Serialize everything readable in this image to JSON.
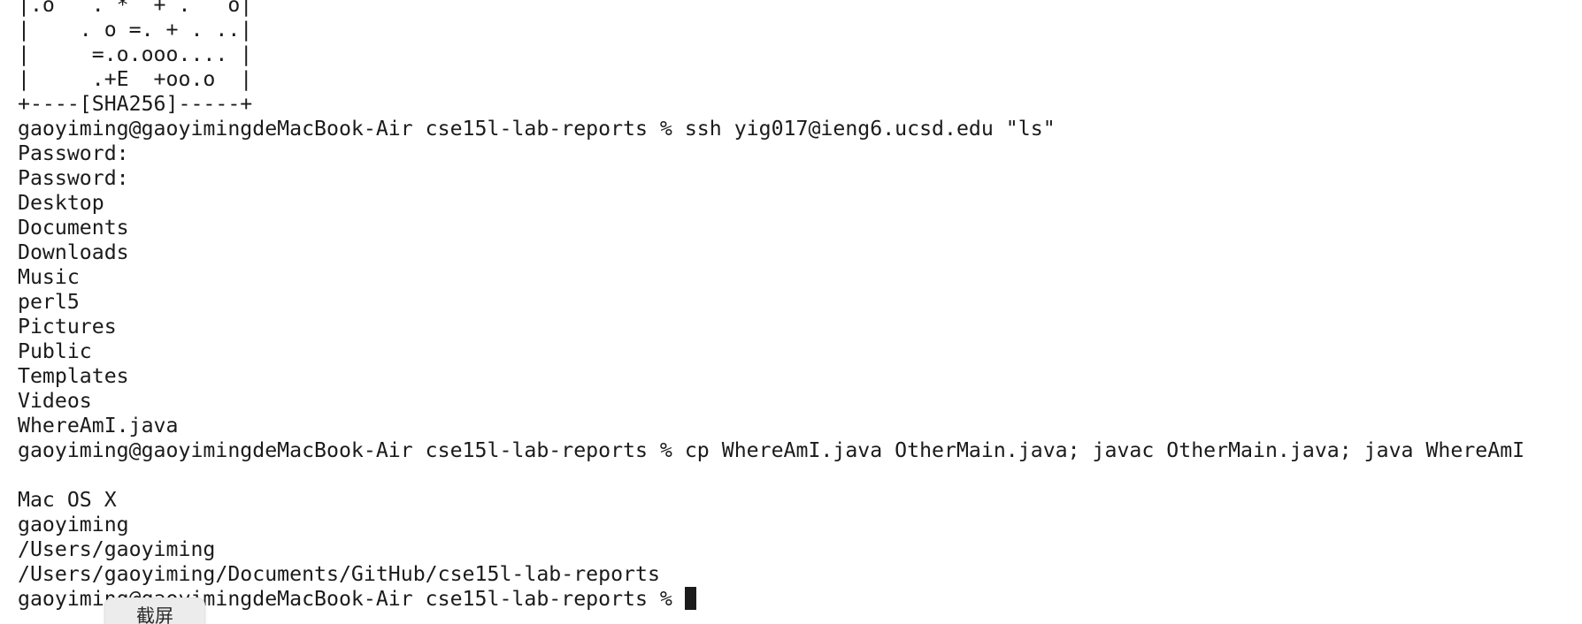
{
  "terminal": {
    "ascii_art": [
      "|.o   . *  + .   o|",
      "|    . o =. + . ..|",
      "|     =.o.ooo.... |",
      "|     .+E  +oo.o  |",
      "+----[SHA256]-----+"
    ],
    "prompt": "gaoyiming@gaoyimingdeMacBook-Air cse15l-lab-reports %",
    "commands": [
      " ssh yig017@ieng6.ucsd.edu \"ls\"",
      " cp WhereAmI.java OtherMain.java; javac OtherMain.java; java WhereAmI"
    ],
    "password_prompts": [
      "Password:",
      "Password:"
    ],
    "ls_output": [
      "Desktop",
      "Documents",
      "Downloads",
      "Music",
      "perl5",
      "Pictures",
      "Public",
      "Templates",
      "Videos",
      "WhereAmI.java"
    ],
    "java_output": [
      "",
      "Mac OS X",
      "gaoyiming",
      "/Users/gaoyiming",
      "/Users/gaoyiming/Documents/GitHub/cse15l-lab-reports"
    ]
  },
  "tooltip": {
    "label": "截屏"
  }
}
